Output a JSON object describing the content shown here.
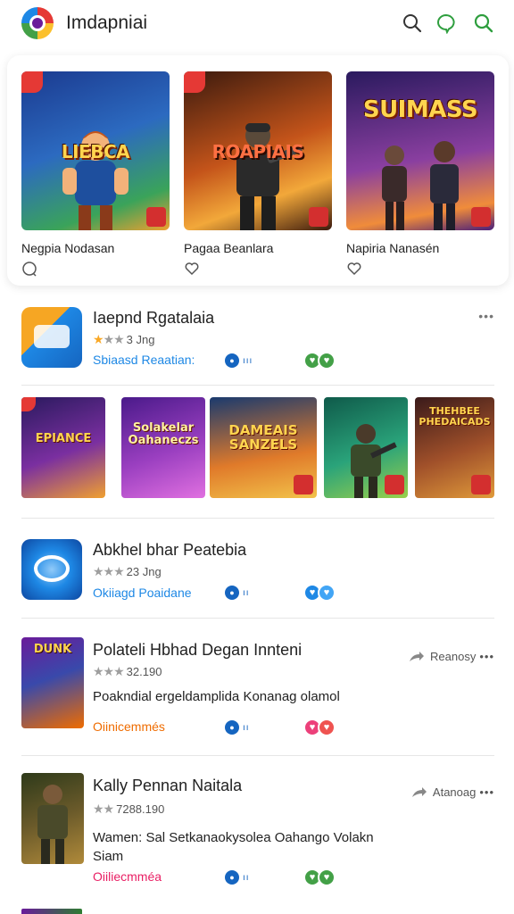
{
  "header": {
    "title": "Imdapniai",
    "icons": [
      "search-icon",
      "chat-bubble-icon",
      "search-icon"
    ],
    "accent": "#2e9e3e"
  },
  "featured": [
    {
      "name": "Negpia Nodasan",
      "art": "LIEBCA",
      "colors": [
        "#1b3a8f",
        "#3aa35a",
        "#f0a030"
      ]
    },
    {
      "name": "Pagaa Beanlara",
      "art": "ROAPIAIS",
      "colors": [
        "#3b1a0e",
        "#c4541a",
        "#f2a83a"
      ]
    },
    {
      "name": "Napiria Nanasén",
      "art": "SUIMASS",
      "colors": [
        "#4a1f7a",
        "#8a3fa0",
        "#f08c3a"
      ]
    }
  ],
  "list": [
    {
      "name": "Iaepnd Rgatalaia",
      "rating": "3 Jng",
      "stars_on": 1,
      "sub": "Sbiaasd Reaatian:",
      "icon": "app-icon-orange-blue"
    },
    {
      "name": "Abkhel bhar Peatebia",
      "rating": "23 Jng",
      "stars_on": 0,
      "sub": "Okiiagd Poaidane",
      "icon": "app-icon-blue-swirl"
    },
    {
      "name": "Polateli Hbhad Degan Innteni",
      "rating": "32.190",
      "stars_on": 0,
      "desc": "Poakndial ergeldamplida Konanag olamol",
      "sub": "Oiinicemmés",
      "share": "Reanosy",
      "icon": "app-icon-dunk"
    },
    {
      "name": "Kally Pennan Naitala",
      "rating": "7288.190",
      "stars_on": 0,
      "desc": "Wamen: Sal Setkanaokysolea Oahango Volakn",
      "desc2": "Siam",
      "sub": "Oiiliecmméa",
      "share": "Atanoag",
      "icon": "app-icon-soldier"
    }
  ],
  "strip": [
    {
      "art": "EPIANCE",
      "colors": [
        "#2a1a5e",
        "#7a2fa0",
        "#f0a030"
      ]
    },
    {
      "art": "Solakelar Oahaneczs",
      "colors": [
        "#4a1a8a",
        "#9a3fc0",
        "#e070e0"
      ]
    },
    {
      "art": "DAMEAIS SANZELS",
      "colors": [
        "#1a3a6e",
        "#e07a2a",
        "#f2c24a"
      ]
    },
    {
      "art": "",
      "colors": [
        "#0f5a4a",
        "#2aa37a",
        "#9ad04a"
      ]
    },
    {
      "art": "THEHBEE PHEDAICADS",
      "colors": [
        "#3a1a1a",
        "#a0502a",
        "#e09a3a"
      ]
    }
  ]
}
